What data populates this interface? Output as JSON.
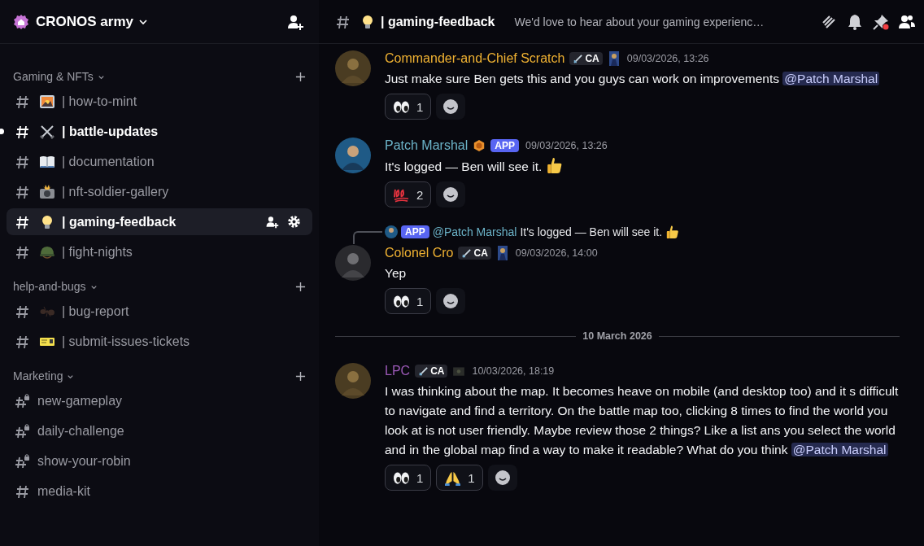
{
  "server": {
    "name": "CRONOS army"
  },
  "sidebar": {
    "categories": [
      {
        "name": "Gaming & NFTs",
        "channels": [
          {
            "name": "| how-to-mint",
            "locked": false,
            "unread": false,
            "selected": false
          },
          {
            "name": "| battle-updates",
            "locked": false,
            "unread": true,
            "selected": false
          },
          {
            "name": "| documentation",
            "locked": false,
            "unread": false,
            "selected": false
          },
          {
            "name": "| nft-soldier-gallery",
            "locked": false,
            "unread": false,
            "selected": false
          },
          {
            "name": "| gaming-feedback",
            "locked": false,
            "unread": false,
            "selected": true
          },
          {
            "name": "| fight-nights",
            "locked": false,
            "unread": false,
            "selected": false
          }
        ]
      },
      {
        "name": "help-and-bugs",
        "channels": [
          {
            "name": "| bug-report",
            "locked": false,
            "unread": false,
            "selected": false
          },
          {
            "name": "| submit-issues-tickets",
            "locked": false,
            "unread": false,
            "selected": false
          }
        ]
      },
      {
        "name": "Marketing",
        "channels": [
          {
            "name": "new-gameplay",
            "locked": true,
            "unread": false,
            "selected": false
          },
          {
            "name": "daily-challenge",
            "locked": true,
            "unread": false,
            "selected": false
          },
          {
            "name": "show-your-robin",
            "locked": true,
            "unread": false,
            "selected": false
          },
          {
            "name": "media-kit",
            "locked": false,
            "unread": false,
            "selected": false
          }
        ]
      }
    ]
  },
  "channel_header": {
    "name": "| gaming-feedback",
    "topic": "We'd love to hear about your gaming experienc…"
  },
  "messages": [
    {
      "kind": "message",
      "author": "Commander-and-Chief Scratch",
      "color": "#f0b232",
      "tag": "CA",
      "time": "09/03/2026, 13:26",
      "text": [
        {
          "text": "Just make sure Ben gets this and you guys can work on improvements "
        },
        {
          "mention": "@Patch Marshal"
        }
      ],
      "reactions": [
        {
          "count": "1"
        }
      ]
    },
    {
      "kind": "message",
      "author": "Patch Marshal",
      "color": "#6cb4c9",
      "app_label": "APP",
      "time": "09/03/2026, 13:26",
      "text": [
        {
          "text": "It's logged — Ben will see it. "
        }
      ],
      "reactions": [
        {
          "count": "2"
        }
      ]
    },
    {
      "kind": "message",
      "author": "Colonel Cro",
      "color": "#f0b232",
      "tag": "CA",
      "time": "09/03/2026, 14:00",
      "reply": {
        "app_label": "APP",
        "mention": "@Patch Marshal",
        "text": "It's logged — Ben will see it."
      },
      "text": [
        {
          "text": "Yep"
        }
      ],
      "reactions": [
        {
          "count": "1"
        }
      ]
    },
    {
      "kind": "divider",
      "label": "10 March 2026"
    },
    {
      "kind": "message",
      "author": "LPC",
      "color": "#9b59b6",
      "tag": "CA",
      "time": "10/03/2026, 18:19",
      "text": [
        {
          "text": "I was thinking about the map. It becomes heave on mobile (and desktop too) and it s difficult to navigate and find a territory. On the battle map too, clicking 8 times to find the world you look at is not user friendly. Maybe review those 2 things? Like a list ans you select the world and in the global map find a way to make it readable? What do you think "
        },
        {
          "mention": "@Patch Marshal"
        }
      ],
      "reactions": [
        {
          "count": "1"
        },
        {
          "count": "1"
        }
      ]
    }
  ]
}
